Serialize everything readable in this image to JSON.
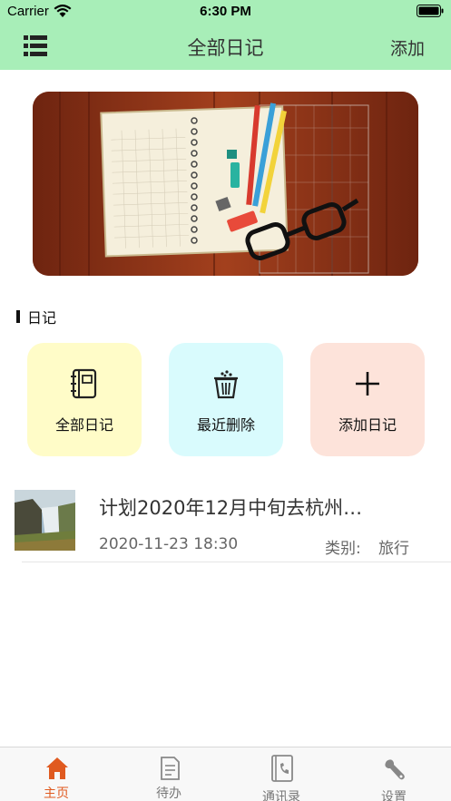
{
  "status": {
    "carrier": "Carrier",
    "time": "6:30 PM"
  },
  "nav": {
    "title": "全部日记",
    "add_label": "添加"
  },
  "section": {
    "title": "日记"
  },
  "cards": [
    {
      "label": "全部日记",
      "icon": "notebook-icon",
      "color": "#fffcc8"
    },
    {
      "label": "最近删除",
      "icon": "trash-icon",
      "color": "#d9fbfd"
    },
    {
      "label": "添加日记",
      "icon": "plus-icon",
      "color": "#fde3da"
    }
  ],
  "diaries": [
    {
      "title": "计划2020年12月中旬去杭州…",
      "date": "2020-11-23 18:30",
      "category_label": "类别:",
      "category": "旅行"
    }
  ],
  "tabs": [
    {
      "label": "主页",
      "icon": "home-icon",
      "active": true
    },
    {
      "label": "待办",
      "icon": "todo-icon",
      "active": false
    },
    {
      "label": "通讯录",
      "icon": "contacts-icon",
      "active": false
    },
    {
      "label": "设置",
      "icon": "wrench-icon",
      "active": false
    }
  ],
  "colors": {
    "nav_background": "#a8eeb8",
    "active_tab": "#e05a20"
  }
}
